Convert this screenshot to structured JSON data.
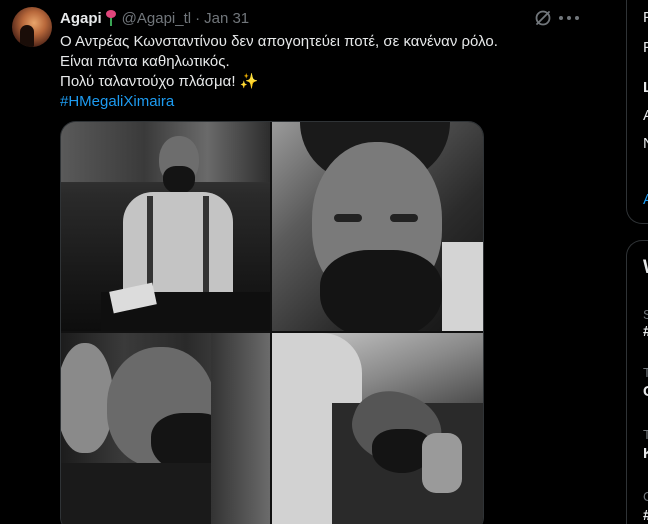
{
  "tweet": {
    "display_name": "Agapi",
    "handle": "@Agapi_tl",
    "separator": "·",
    "date": "Jan 31",
    "lines": [
      "Ο Αντρέας Κωνσταντίνου δεν απογοητεύει ποτέ, σε κανέναν ρόλο.",
      "Είναι πάντα καθηλωτικός.",
      "Πολύ ταλαντούχο πλάσμα! "
    ],
    "sparkle": "✨",
    "hashtag": "#HMegaliXimaira"
  },
  "icons": {
    "avatar": "avatar-image",
    "name_emoji": "flower-icon",
    "grok": "grok-icon",
    "more": "more-icon"
  },
  "sidebar": {
    "card1": [
      "F",
      "P",
      "L",
      "A",
      "N",
      "A"
    ],
    "card2": [
      "W",
      "S",
      "#",
      "T",
      "C",
      "T",
      "K",
      "C",
      "#"
    ]
  },
  "colors": {
    "background": "#000000",
    "text": "#e7e9ea",
    "muted": "#71767b",
    "accent": "#1d9bf0",
    "border": "#2f3336"
  }
}
